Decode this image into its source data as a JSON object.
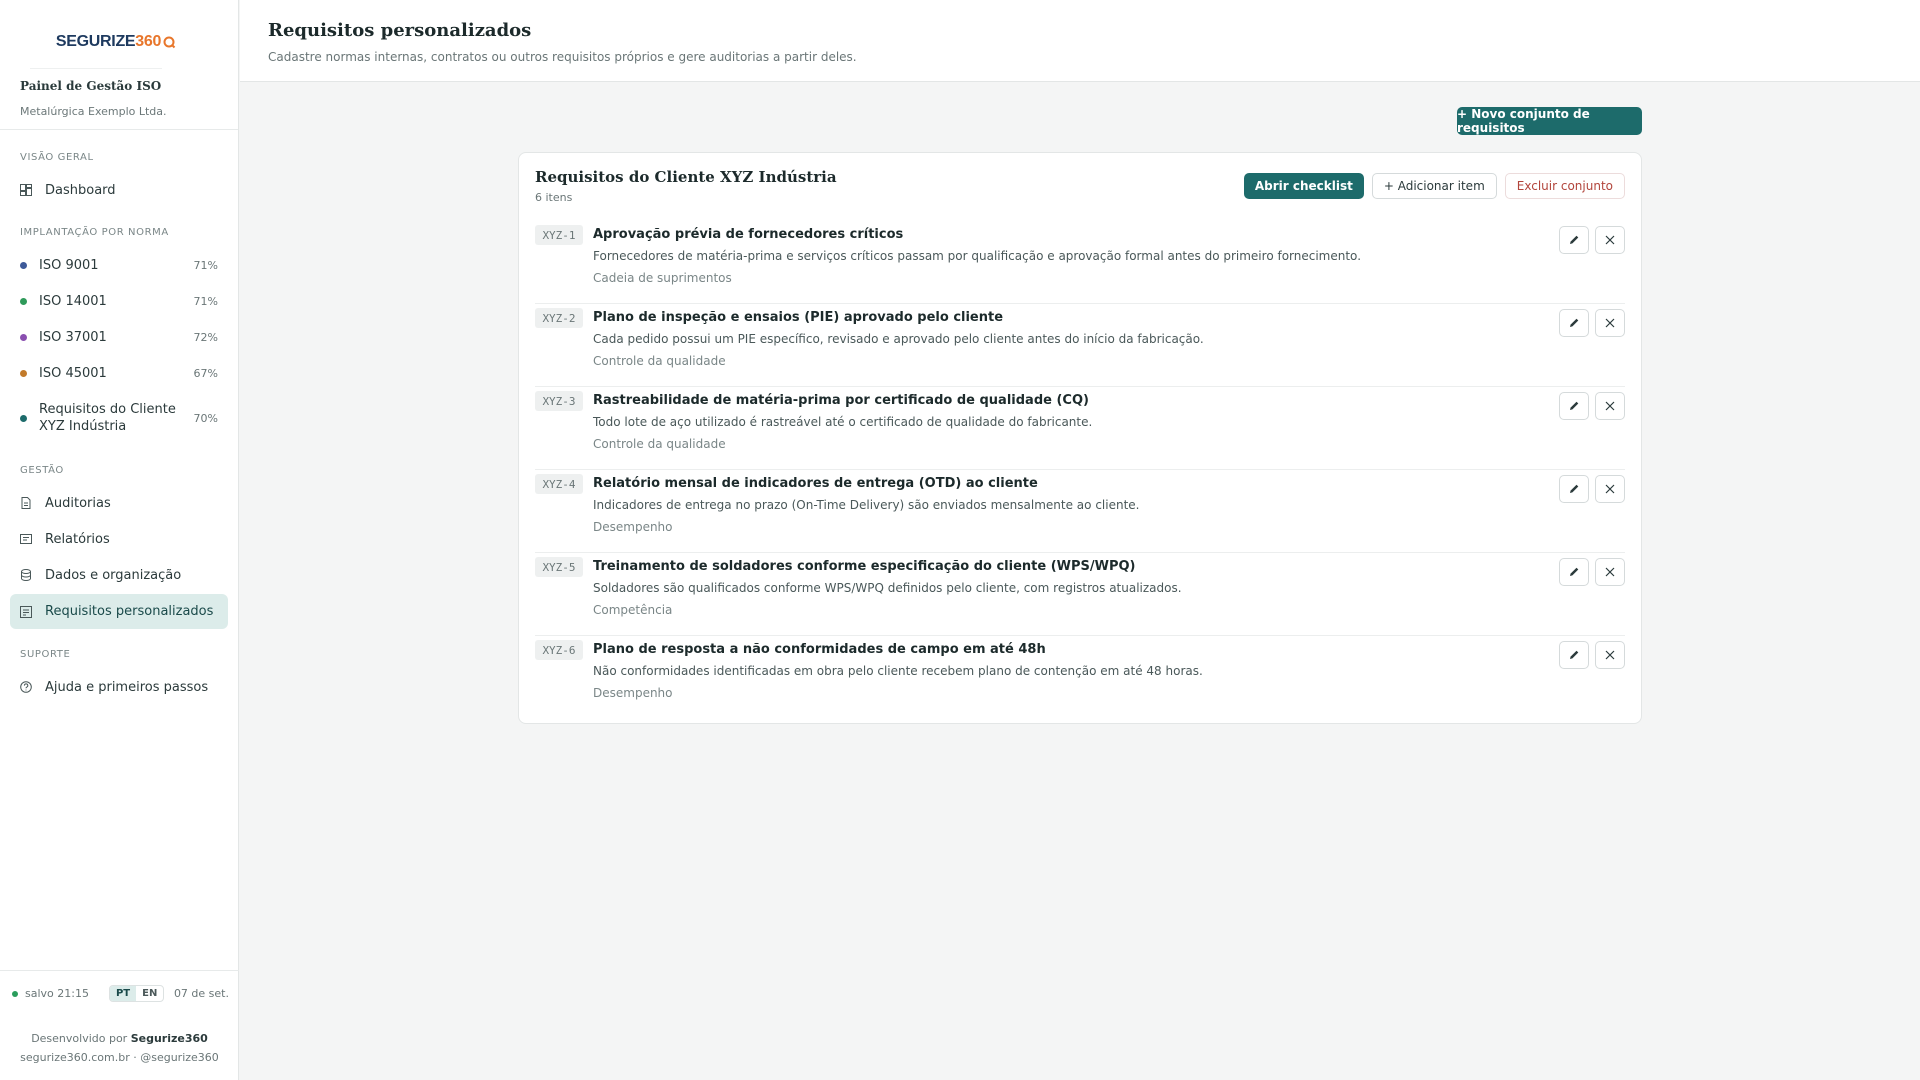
{
  "brand": {
    "logo_part1": "SEGURIZE",
    "logo_part2": "360",
    "title": "Painel de Gestão ISO",
    "company": "Metalúrgica Exemplo Ltda."
  },
  "sidebar": {
    "section_overview": "VISÃO GERAL",
    "dashboard": "Dashboard",
    "section_norms": "IMPLANTAÇÃO POR NORMA",
    "norms": [
      {
        "label": "ISO 9001",
        "pct": "71%",
        "color": "#3d5a99"
      },
      {
        "label": "ISO 14001",
        "pct": "71%",
        "color": "#2f9a5a"
      },
      {
        "label": "ISO 37001",
        "pct": "72%",
        "color": "#8a4fb0"
      },
      {
        "label": "ISO 45001",
        "pct": "67%",
        "color": "#c27a2a"
      },
      {
        "label_line1": "Requisitos do Cliente",
        "label_line2": "XYZ Indústria",
        "pct": "70%",
        "color": "#1d6b6b"
      }
    ],
    "section_management": "GESTÃO",
    "management": [
      "Auditorias",
      "Relatórios",
      "Dados e organização",
      "Requisitos personalizados"
    ],
    "section_support": "SUPORTE",
    "help": "Ajuda e primeiros passos"
  },
  "footer": {
    "saved": "salvo 21:15",
    "lang_pt": "PT",
    "lang_en": "EN",
    "date": "07 de set.",
    "developed_by": "Desenvolvido por",
    "developer": "Segurize360",
    "site": "segurize360.com.br",
    "separator": "·",
    "handle": "@segurize360"
  },
  "header": {
    "title": "Requisitos personalizados",
    "subtitle": "Cadastre normas internas, contratos ou outros requisitos próprios e gere auditorias a partir deles."
  },
  "new_set_button": "+ Novo conjunto de requisitos",
  "card": {
    "title": "Requisitos do Cliente XYZ Indústria",
    "count": "6 itens",
    "open_checklist": "Abrir checklist",
    "add_item": "+ Adicionar item",
    "delete_set": "Excluir conjunto",
    "items": [
      {
        "code": "XYZ-1",
        "title": "Aprovação prévia de fornecedores críticos",
        "desc": "Fornecedores de matéria-prima e serviços críticos passam por qualificação e aprovação formal antes do primeiro fornecimento.",
        "category": "Cadeia de suprimentos"
      },
      {
        "code": "XYZ-2",
        "title": "Plano de inspeção e ensaios (PIE) aprovado pelo cliente",
        "desc": "Cada pedido possui um PIE específico, revisado e aprovado pelo cliente antes do início da fabricação.",
        "category": "Controle da qualidade"
      },
      {
        "code": "XYZ-3",
        "title": "Rastreabilidade de matéria-prima por certificado de qualidade (CQ)",
        "desc": "Todo lote de aço utilizado é rastreável até o certificado de qualidade do fabricante.",
        "category": "Controle da qualidade"
      },
      {
        "code": "XYZ-4",
        "title": "Relatório mensal de indicadores de entrega (OTD) ao cliente",
        "desc": "Indicadores de entrega no prazo (On-Time Delivery) são enviados mensalmente ao cliente.",
        "category": "Desempenho"
      },
      {
        "code": "XYZ-5",
        "title": "Treinamento de soldadores conforme especificação do cliente (WPS/WPQ)",
        "desc": "Soldadores são qualificados conforme WPS/WPQ definidos pelo cliente, com registros atualizados.",
        "category": "Competência"
      },
      {
        "code": "XYZ-6",
        "title": "Plano de resposta a não conformidades de campo em até 48h",
        "desc": "Não conformidades identificadas em obra pelo cliente recebem plano de contenção em até 48 horas.",
        "category": "Desempenho"
      }
    ]
  },
  "colors": {
    "accent": "#1d6b6b",
    "active_bg": "#dcecea",
    "danger": "#b2453c"
  }
}
